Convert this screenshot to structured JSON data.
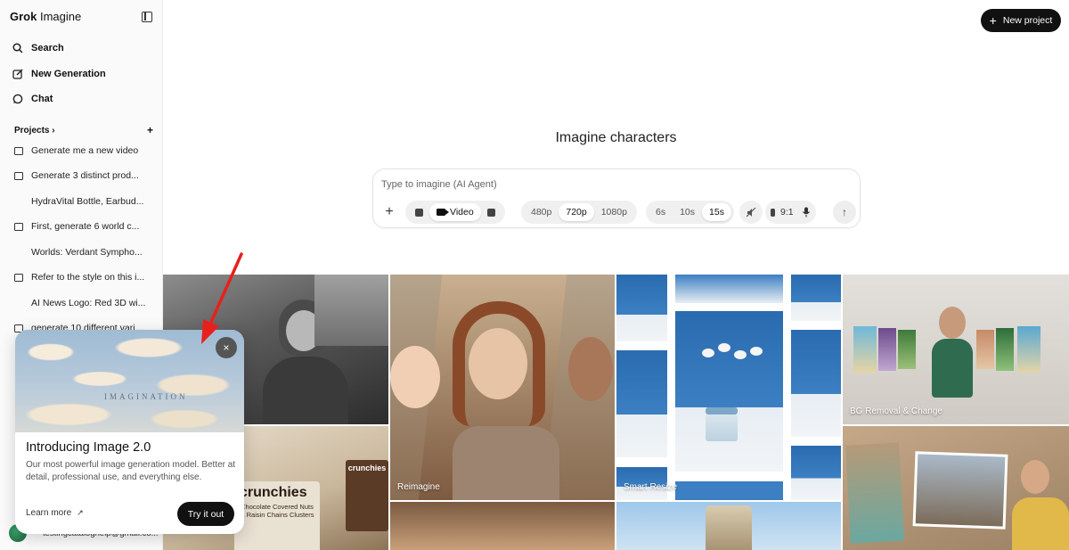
{
  "brand": {
    "name_bold": "Grok",
    "name_rest": " Imagine"
  },
  "nav": [
    {
      "label": "Search",
      "icon": "search-icon"
    },
    {
      "label": "New Generation",
      "icon": "edit-icon"
    },
    {
      "label": "Chat",
      "icon": "chat-icon"
    }
  ],
  "projects": {
    "header": "Projects",
    "chevron": "›",
    "add": "+",
    "items": [
      {
        "label": "Generate me a new video",
        "type": "folder"
      },
      {
        "label": "Generate 3 distinct prod...",
        "type": "folder"
      },
      {
        "label": "HydraVital Bottle, Earbud...",
        "type": "child"
      },
      {
        "label": "First, generate 6 world c...",
        "type": "folder"
      },
      {
        "label": "Worlds: Verdant Sympho...",
        "type": "child"
      },
      {
        "label": "Refer to the style on this i...",
        "type": "folder"
      },
      {
        "label": "AI News Logo: Red 3D wi...",
        "type": "child"
      },
      {
        "label": "generate 10 different vari...",
        "type": "folder"
      }
    ]
  },
  "account": {
    "email": "testingcataloghelp@gmail.co..."
  },
  "popup": {
    "image_text": "IMAGINATION",
    "close": "×",
    "title": "Introducing Image 2.0",
    "description": "Our most powerful image generation model. Better at detail, professional use, and everything else.",
    "learn_more": "Learn more",
    "learn_more_arrow": "↗",
    "cta": "Try it out"
  },
  "header": {
    "new_project": "New project",
    "new_project_icon": "+"
  },
  "main": {
    "heading": "Imagine characters"
  },
  "prompt": {
    "placeholder": "Type to imagine (AI Agent)",
    "add": "+",
    "mode_video": "Video",
    "resolutions": [
      "480p",
      "720p",
      "1080p"
    ],
    "active_resolution": "720p",
    "durations": [
      "6s",
      "10s",
      "15s"
    ],
    "active_duration": "15s",
    "aspect": "9:1",
    "send": "↑"
  },
  "gallery": {
    "labels": {
      "reimagine": "Reimagine",
      "smart_resize": "Smart Resize",
      "bg_removal": "BG Removal & Change"
    },
    "snack_brand": "crunchies",
    "snack_desc": "Chocolate Covered Nuts & Raisin Chains Clusters",
    "snack_small": "crunchies"
  },
  "colors": {
    "accent_dark": "#111111",
    "arrow_red": "#e8201c"
  }
}
